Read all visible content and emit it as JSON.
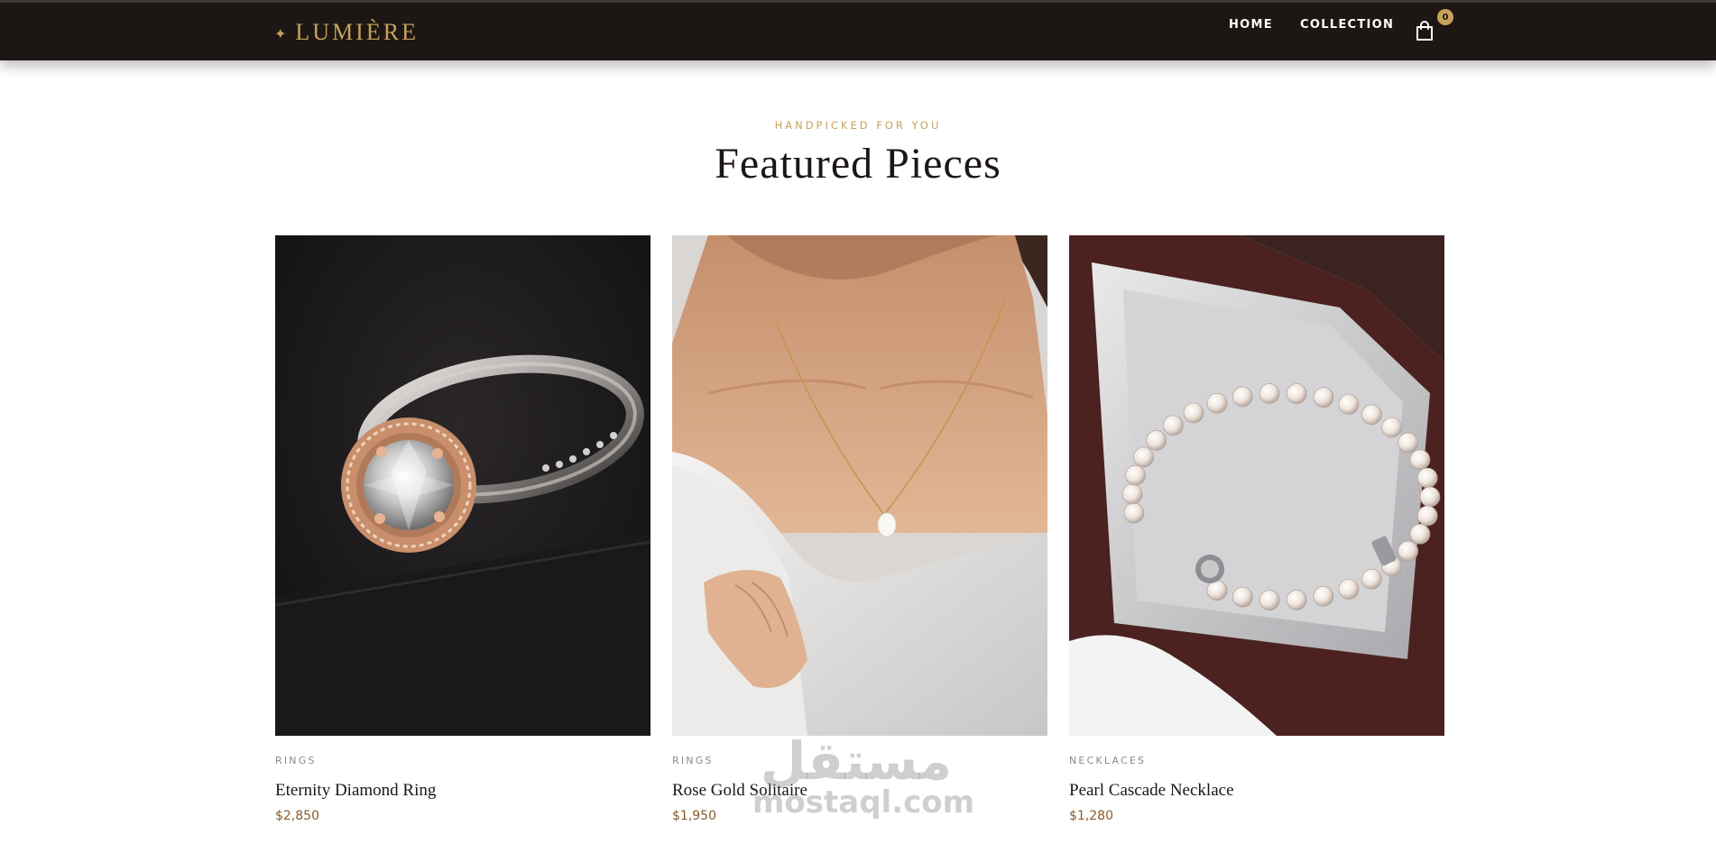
{
  "brand": {
    "mark": "✦",
    "name": "LUMIÈRE",
    "accent_color": "#c8a15a",
    "header_color": "#1c1714"
  },
  "nav": {
    "home": "HOME",
    "collection": "COLLECTION",
    "cart_icon": "shopping-bag-icon",
    "cart_count": "0"
  },
  "section": {
    "eyebrow": "HANDPICKED FOR YOU",
    "title": "Featured Pieces"
  },
  "products": [
    {
      "category": "RINGS",
      "name": "Eternity Diamond Ring",
      "price": "$2,850",
      "image": "diamond-ring-photo"
    },
    {
      "category": "RINGS",
      "name": "Rose Gold Solitaire",
      "price": "$1,950",
      "image": "pearl-pendant-necklace-photo"
    },
    {
      "category": "NECKLACES",
      "name": "Pearl Cascade Necklace",
      "price": "$1,280",
      "image": "pearl-necklace-box-photo"
    }
  ],
  "watermark": {
    "arabic": "مستقل",
    "latin": "mostaql.com"
  }
}
